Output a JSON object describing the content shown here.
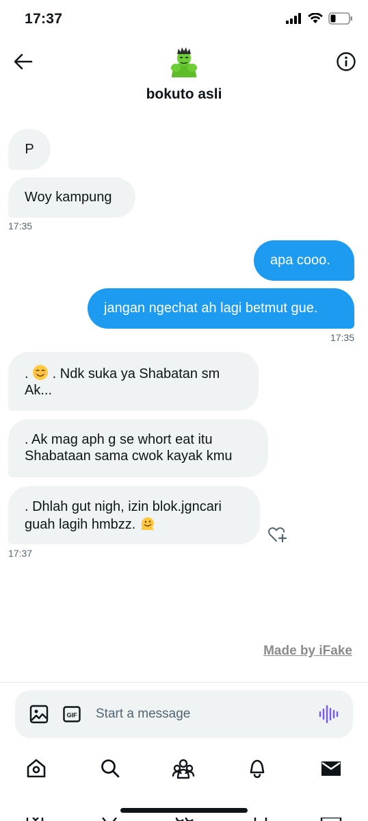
{
  "status_bar": {
    "time": "17:37"
  },
  "header": {
    "contact_name": "bokuto asli"
  },
  "messages": [
    {
      "direction": "in",
      "text": "P"
    },
    {
      "direction": "in",
      "text": "Woy kampung",
      "time": "17:35"
    },
    {
      "direction": "out",
      "text": "apa cooo."
    },
    {
      "direction": "out",
      "text": "jangan ngechat ah lagi betmut gue.",
      "time": "17:35"
    },
    {
      "direction": "in",
      "line1_prefix": ". ",
      "line1_emoji": "smiling-face-emoji",
      "line1_text": " . Ndk suka ya Shabatan sm",
      "line2": "Ak..."
    },
    {
      "direction": "in",
      "line1": ". Ak mag aph g se whort eat itu",
      "line2": "Shabataan sama cwok kayak kmu"
    },
    {
      "direction": "in",
      "line1": ". Dhlah gut nigh, izin blok.jgncari",
      "line2": "guah lagih hmbzz. ",
      "line2_emoji": "melting-face-emoji",
      "time": "17:37"
    }
  ],
  "watermark": "Made by iFake",
  "composer": {
    "placeholder": "Start a message",
    "gif_label": "GIF"
  },
  "colors": {
    "accent": "#1d9bf0",
    "incoming_bubble": "#eff3f4",
    "voice": "#7856ff",
    "text": "#0f1419",
    "muted": "#536471"
  },
  "tabbar": {
    "items": [
      "home-icon",
      "search-icon",
      "communities-icon",
      "notifications-icon",
      "messages-icon"
    ]
  }
}
